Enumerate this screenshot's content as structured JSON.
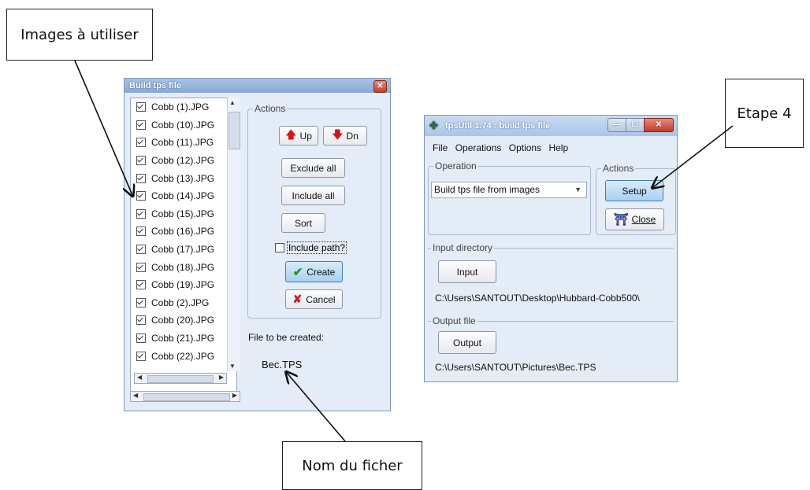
{
  "annotations": {
    "images_label": "Images à utiliser",
    "step_label": "Etape 4",
    "filename_label": "Nom du ficher"
  },
  "build_window": {
    "title": "Build tps file",
    "close_glyph": "✕",
    "files": [
      {
        "name": "Cobb (1).JPG",
        "checked": true
      },
      {
        "name": "Cobb (10).JPG",
        "checked": true
      },
      {
        "name": "Cobb (11).JPG",
        "checked": true
      },
      {
        "name": "Cobb (12).JPG",
        "checked": true
      },
      {
        "name": "Cobb (13).JPG",
        "checked": true
      },
      {
        "name": "Cobb (14).JPG",
        "checked": true
      },
      {
        "name": "Cobb (15).JPG",
        "checked": true
      },
      {
        "name": "Cobb (16).JPG",
        "checked": true
      },
      {
        "name": "Cobb (17).JPG",
        "checked": true
      },
      {
        "name": "Cobb (18).JPG",
        "checked": true
      },
      {
        "name": "Cobb (19).JPG",
        "checked": true
      },
      {
        "name": "Cobb (2).JPG",
        "checked": true
      },
      {
        "name": "Cobb (20).JPG",
        "checked": true
      },
      {
        "name": "Cobb (21).JPG",
        "checked": true
      },
      {
        "name": "Cobb (22).JPG",
        "checked": true
      }
    ],
    "actions_legend": "Actions",
    "up_label": "Up",
    "dn_label": "Dn",
    "exclude_all": "Exclude all",
    "include_all": "Include all",
    "sort": "Sort",
    "include_path": "Include path?",
    "include_path_checked": false,
    "create": "Create",
    "cancel": "Cancel",
    "file_to_create_label": "File to be created:",
    "file_name": "Bec.TPS"
  },
  "tpsutil_window": {
    "title": "tpsUtil 1.74 : build tps file",
    "menu": [
      "File",
      "Operations",
      "Options",
      "Help"
    ],
    "operation_legend": "Operation",
    "operation_value": "Build tps file from images",
    "actions_legend": "Actions",
    "setup": "Setup",
    "close": "Close",
    "input_dir_legend": "Input directory",
    "input_button": "Input",
    "input_path": "C:\\Users\\SANTOUT\\Desktop\\Hubbard-Cobb500\\",
    "output_legend": "Output file",
    "output_button": "Output",
    "output_path": "C:\\Users\\SANTOUT\\Pictures\\Bec.TPS"
  }
}
